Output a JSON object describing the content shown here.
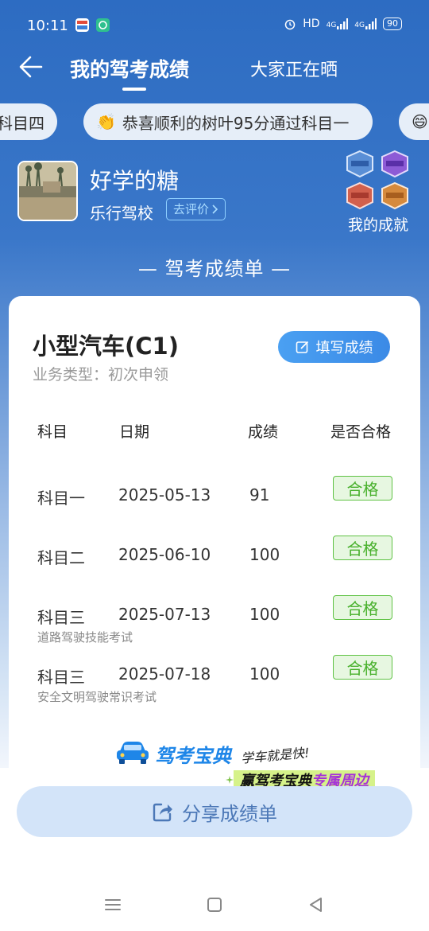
{
  "status_bar": {
    "time": "10:11",
    "hd": "HD",
    "net1": "4G",
    "net2": "4G",
    "battery": "90"
  },
  "nav": {
    "active_tab": "我的驾考成绩",
    "other_tab": "大家正在晒"
  },
  "ticker": {
    "left_pill": "科目四",
    "center_pill": "恭喜顺利的树叶95分通过科目一",
    "center_emoji": "👏",
    "right_emoji": "😄"
  },
  "profile": {
    "username": "好学的糖",
    "school": "乐行驾校",
    "rate_label": "去评价",
    "achievements_label": "我的成就"
  },
  "section_title": "— 驾考成绩单 —",
  "card": {
    "vehicle": "小型汽车(C1)",
    "business_type": "业务类型：初次申领",
    "fill_button": "填写成绩",
    "headers": [
      "科目",
      "日期",
      "成绩",
      "是否合格"
    ],
    "rows": [
      {
        "subject": "科目一",
        "date": "2025-05-13",
        "score": "91",
        "status": "合格",
        "note": ""
      },
      {
        "subject": "科目二",
        "date": "2025-06-10",
        "score": "100",
        "status": "合格",
        "note": ""
      },
      {
        "subject": "科目三",
        "date": "2025-07-13",
        "score": "100",
        "status": "合格",
        "note": "道路驾驶技能考试"
      },
      {
        "subject": "科目三",
        "date": "2025-07-18",
        "score": "100",
        "status": "合格",
        "note": "安全文明驾驶常识考试"
      }
    ]
  },
  "brand": {
    "name": "驾考宝典",
    "slogan": "学车就是快!",
    "promo_prefix": "赢驾考宝典",
    "promo_highlight": "专属周边"
  },
  "share_button": "分享成绩单",
  "colors": {
    "primary_blue": "#2d6cc2",
    "pass_green": "#48b02c",
    "button_blue": "#3b8ae6"
  }
}
